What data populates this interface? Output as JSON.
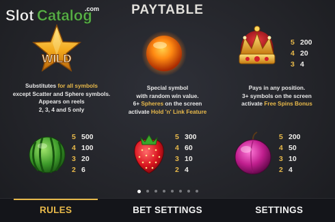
{
  "watermark": {
    "slot": "Slot",
    "catalog": "Catalog",
    "com": ".com"
  },
  "title": "PAYTABLE",
  "symbols": {
    "wild": {
      "label": "WILD",
      "line1_a": "Substitutes ",
      "line1_b": "for all symbols",
      "line2_a": "except Scatter and Sphere symbols.",
      "line3": "Appears on reels",
      "line4": "2, 3, 4 and 5 only"
    },
    "sphere": {
      "line1": "Special symbol",
      "line2": "with random win value.",
      "line3_a": "6+ ",
      "line3_b": "Spheres",
      "line3_c": " on the screen",
      "line4_a": "activate ",
      "line4_b": "Hold 'n' Link Feature"
    },
    "crown": {
      "pays": [
        {
          "k": "5",
          "v": "200"
        },
        {
          "k": "4",
          "v": "20"
        },
        {
          "k": "3",
          "v": "4"
        }
      ],
      "line1": "Pays in any position.",
      "line2": "3+ symbols on the screen",
      "line3_a": "activate ",
      "line3_b": "Free Spins Bonus"
    },
    "watermelon": {
      "pays": [
        {
          "k": "5",
          "v": "500"
        },
        {
          "k": "4",
          "v": "100"
        },
        {
          "k": "3",
          "v": "20"
        },
        {
          "k": "2",
          "v": "6"
        }
      ]
    },
    "strawberry": {
      "pays": [
        {
          "k": "5",
          "v": "300"
        },
        {
          "k": "4",
          "v": "60"
        },
        {
          "k": "3",
          "v": "10"
        },
        {
          "k": "2",
          "v": "4"
        }
      ]
    },
    "plum": {
      "pays": [
        {
          "k": "5",
          "v": "200"
        },
        {
          "k": "4",
          "v": "50"
        },
        {
          "k": "3",
          "v": "10"
        },
        {
          "k": "2",
          "v": "4"
        }
      ]
    }
  },
  "pagination": {
    "pages": 8,
    "current": 1
  },
  "tabs": [
    {
      "label": "RULES"
    },
    {
      "label": "BET SETTINGS"
    },
    {
      "label": "SETTINGS"
    }
  ]
}
